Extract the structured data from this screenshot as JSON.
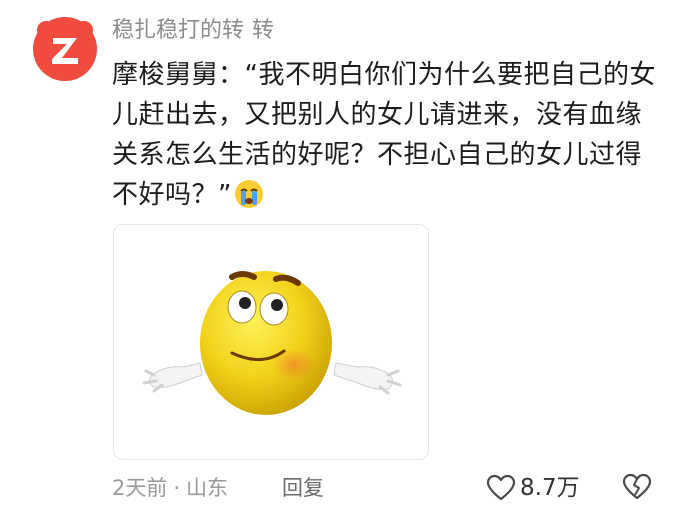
{
  "comment": {
    "username": "稳扎稳打的转",
    "username_tag": "转",
    "text": "摩梭舅舅：“我不明白你们为什么要把自己的女儿赶出去，又把别人的女儿请进来，没有血缘关系怎么生活的好呢？不担心自己的女儿过得不好吗？”",
    "emoji_icon": "crying-face-icon",
    "attached_image_icon": "shrugging-smiley-sticker",
    "time": "2天前",
    "separator": "·",
    "location": "山东",
    "reply_label": "回复",
    "like_count": "8.7万"
  },
  "colors": {
    "avatar_bg": "#f04b3c",
    "meta_text": "#9a9a9a"
  }
}
